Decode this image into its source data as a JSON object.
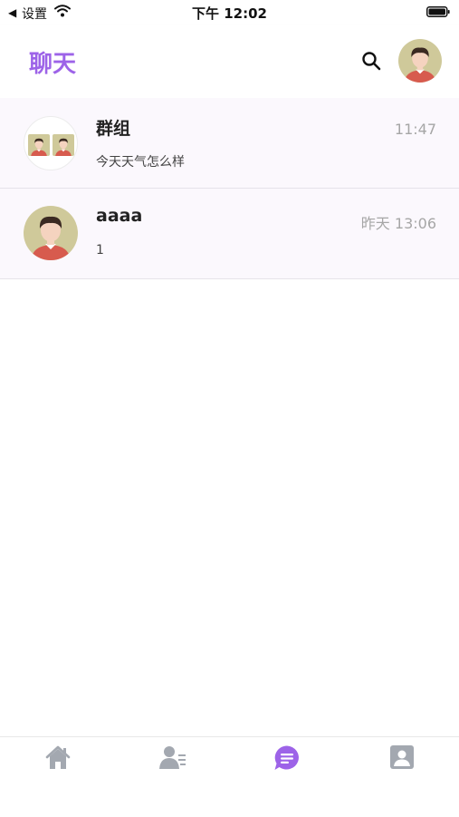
{
  "status_bar": {
    "back_arrow": "◀",
    "carrier": "设置",
    "time": "下午 12:02",
    "wifi_icon": "wifi-icon",
    "battery_icon": "battery-icon"
  },
  "header": {
    "title": "聊天",
    "search_icon": "search-icon",
    "avatar_icon": "user-avatar-icon"
  },
  "chats": [
    {
      "name": "群组",
      "time": "11:47",
      "last_message": "今天天气怎么样",
      "avatar": "group-avatar"
    },
    {
      "name": "aaaa",
      "time": "昨天 13:06",
      "last_message": "1",
      "avatar": "user-avatar"
    }
  ],
  "tabbar": {
    "tabs": [
      {
        "icon": "home-icon",
        "active": false
      },
      {
        "icon": "contacts-icon",
        "active": false
      },
      {
        "icon": "chat-bubble-icon",
        "active": true
      },
      {
        "icon": "profile-card-icon",
        "active": false
      }
    ]
  },
  "colors": {
    "accent": "#9d63e8",
    "inactive_icon": "#a3a8b0",
    "list_bg": "#fbf8fd",
    "avatar_bg": "#cfc99a",
    "shirt": "#d75b4e",
    "hair": "#3b2a22",
    "skin": "#f5d3bf"
  }
}
